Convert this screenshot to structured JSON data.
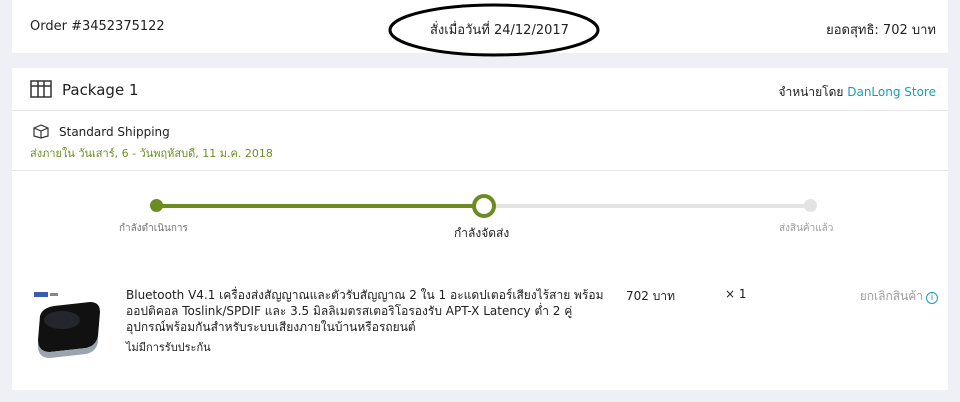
{
  "order": {
    "id": "Order #3452375122",
    "placed_date": "สั่งเมื่อวันที่ 24/12/2017",
    "total": "ยอดสุทธิ: 702 บาท"
  },
  "package": {
    "title": "Package 1",
    "seller_prefix": "จำหน่ายโดย",
    "seller_name": "DanLong Store",
    "shipping_method": "Standard Shipping",
    "delivery_estimate": "ส่งภายใน วันเสาร์, 6 - วันพฤหัสบดี, 11 ม.ค. 2018"
  },
  "progress": {
    "steps": [
      "กำลังดำเนินการ",
      "กำลังจัดส่ง",
      "ส่งสินค้าแล้ว"
    ],
    "current_step": 2,
    "active_color": "#6b8c21",
    "inactive_color": "#e3e3e3"
  },
  "item": {
    "name": "Bluetooth V4.1 เครื่องส่งสัญญาณและตัวรับสัญญาณ 2 ใน 1 อะแดปเตอร์เสียงไร้สาย พร้อมออปติคอล Toslink/SPDIF และ 3.5 มิลลิเมตรสเตอริโอรองรับ APT-X Latency ต่ำ 2 คู่อุปกรณ์พร้อมกันสำหรับระบบเสียงภายในบ้านหรือรถยนต์",
    "warranty": "ไม่มีการรับประกัน",
    "price": "702 บาท",
    "quantity": "× 1",
    "cancel_label": "ยกเลิกสินค้า"
  },
  "colors": {
    "link": "#1a9cb7",
    "eta": "#6b8e23"
  }
}
